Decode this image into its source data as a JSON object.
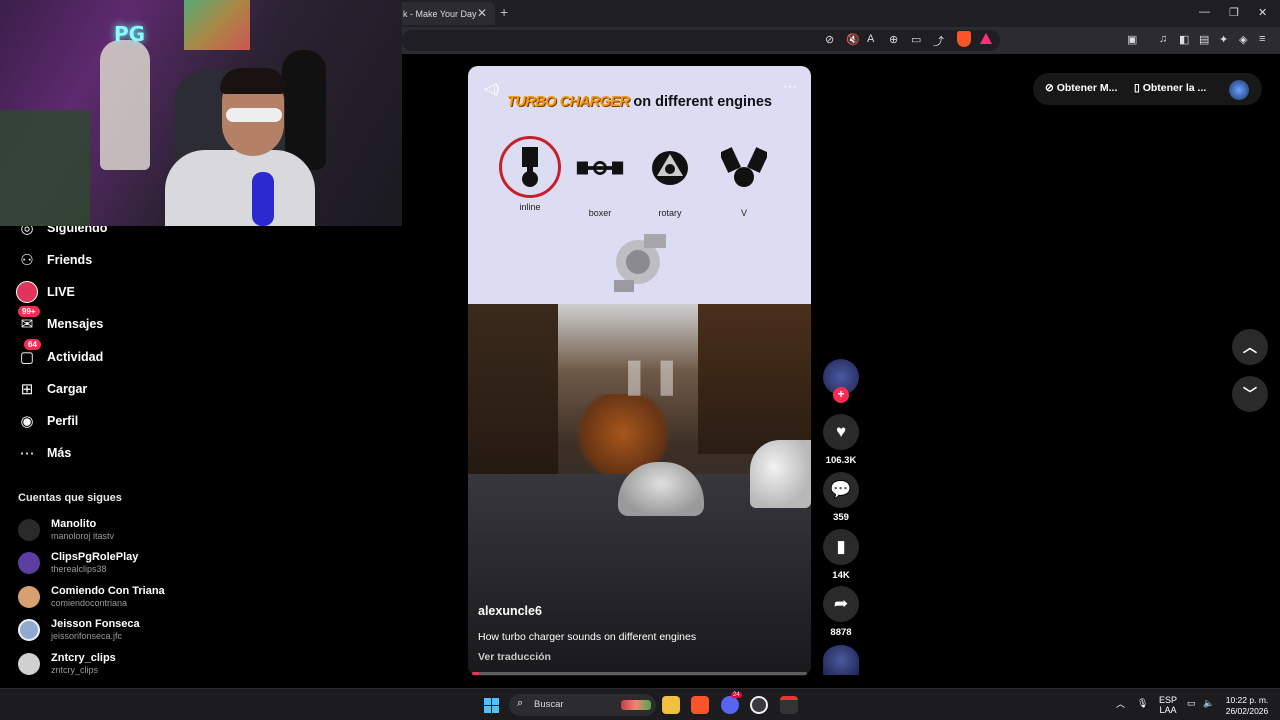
{
  "browser": {
    "tab_title": "k - Make Your Day",
    "tab_close": "✕",
    "new_tab": "+",
    "window_controls": {
      "minimize": "—",
      "restore": "❐",
      "close": "✕"
    }
  },
  "sidebar": {
    "items": [
      {
        "label": "Siguiendo",
        "icon": "following-icon"
      },
      {
        "label": "Friends",
        "icon": "friends-icon"
      },
      {
        "label": "LIVE",
        "icon": "live-icon"
      },
      {
        "label": "Mensajes",
        "icon": "messages-icon",
        "badge": "99+"
      },
      {
        "label": "Actividad",
        "icon": "activity-icon",
        "badge": "64"
      },
      {
        "label": "Cargar",
        "icon": "upload-icon"
      },
      {
        "label": "Perfil",
        "icon": "profile-icon"
      },
      {
        "label": "Más",
        "icon": "more-icon"
      }
    ],
    "following_title": "Cuentas que sigues",
    "accounts": [
      {
        "name": "Manolito",
        "username": "manoloroj itastv"
      },
      {
        "name": "ClipsPgRolePlay",
        "username": "therealclips38"
      },
      {
        "name": "Comiendo Con Triana",
        "username": "comiendocontriana"
      },
      {
        "name": "Jeisson Fonseca",
        "username": "jeissonfonseca.jfc"
      },
      {
        "name": "Zntcry_clips",
        "username": "zntcry_clips"
      }
    ]
  },
  "webcam": {
    "neon_sign": "PG"
  },
  "header_pills": {
    "get_app": "Obtener M...",
    "get_mobile": "Obtener la ..."
  },
  "video": {
    "inset_title_highlight": "TURBO CHARGER",
    "inset_title_rest": "on different engines",
    "engines": [
      "inline",
      "boxer",
      "rotary",
      "V"
    ],
    "author": "alexuncle6",
    "description": "How turbo charger sounds on different engines",
    "translate": "Ver traducción",
    "progress": 0.02
  },
  "actions": {
    "likes": "106.3K",
    "comments": "359",
    "saves": "14K",
    "shares": "8878"
  },
  "taskbar": {
    "search_placeholder": "Buscar",
    "lang_top": "ESP",
    "lang_bottom": "LAA",
    "time": "10:22 p. m.",
    "date": "26/02/2026",
    "discord_badge": "24"
  },
  "colors": {
    "accent": "#fe2c55",
    "brave": "#fb542b",
    "turbo": "#f29a10"
  }
}
